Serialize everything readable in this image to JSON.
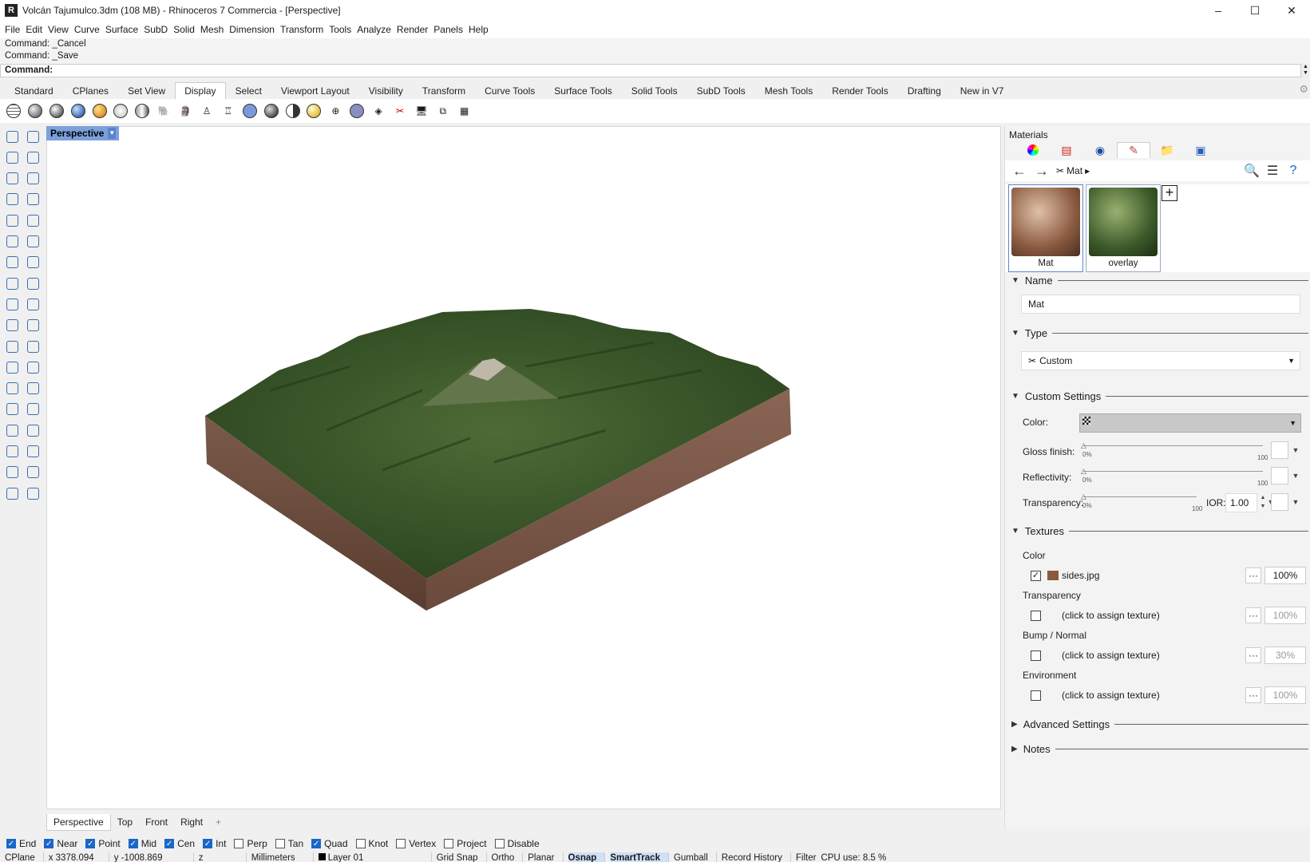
{
  "window": {
    "title": "Volcán Tajumulco.3dm (108 MB) - Rhinoceros 7 Commercia - [Perspective]",
    "minimize": "–",
    "maximize": "☐",
    "close": "✕"
  },
  "menubar": [
    "File",
    "Edit",
    "View",
    "Curve",
    "Surface",
    "SubD",
    "Solid",
    "Mesh",
    "Dimension",
    "Transform",
    "Tools",
    "Analyze",
    "Render",
    "Panels",
    "Help"
  ],
  "command": {
    "history": [
      "Command: _Cancel",
      "Command: _Save"
    ],
    "prompt": "Command:"
  },
  "toolbar_tabs": [
    "Standard",
    "CPlanes",
    "Set View",
    "Display",
    "Select",
    "Viewport Layout",
    "Visibility",
    "Transform",
    "Curve Tools",
    "Surface Tools",
    "Solid Tools",
    "SubD Tools",
    "Mesh Tools",
    "Render Tools",
    "Drafting",
    "New in V7"
  ],
  "active_toolbar_tab": "Display",
  "viewport": {
    "label": "Perspective",
    "tabs": [
      "Perspective",
      "Top",
      "Front",
      "Right"
    ],
    "add_tab": "+"
  },
  "osnaps": [
    {
      "label": "End",
      "checked": true
    },
    {
      "label": "Near",
      "checked": true
    },
    {
      "label": "Point",
      "checked": true
    },
    {
      "label": "Mid",
      "checked": true
    },
    {
      "label": "Cen",
      "checked": true
    },
    {
      "label": "Int",
      "checked": true
    },
    {
      "label": "Perp",
      "checked": false
    },
    {
      "label": "Tan",
      "checked": false
    },
    {
      "label": "Quad",
      "checked": true
    },
    {
      "label": "Knot",
      "checked": false
    },
    {
      "label": "Vertex",
      "checked": false
    },
    {
      "label": "Project",
      "checked": false
    },
    {
      "label": "Disable",
      "checked": false
    }
  ],
  "statusbar": {
    "cplane": "CPlane",
    "x": "x 3378.094",
    "y": "y -1008.869",
    "z": "z",
    "units": "Millimeters",
    "layer": "Layer 01",
    "toggles": [
      "Grid Snap",
      "Ortho",
      "Planar",
      "Osnap",
      "SmartTrack",
      "Gumball",
      "Record History",
      "Filter"
    ],
    "cpu": "CPU use: 8.5 %"
  },
  "materials_panel": {
    "title": "Materials",
    "breadcrumb": "Mat",
    "materials": [
      {
        "name": "Mat"
      },
      {
        "name": "overlay"
      }
    ],
    "sections": {
      "name": "Name",
      "type": "Type",
      "custom": "Custom Settings",
      "textures": "Textures",
      "advanced": "Advanced Settings",
      "notes": "Notes"
    },
    "name_value": "Mat",
    "type_value": "Custom",
    "color_label": "Color:",
    "gloss_label": "Gloss finish:",
    "reflectivity_label": "Reflectivity:",
    "transparency_label": "Transparency:",
    "slider_min": "0%",
    "slider_max": "100",
    "ior_label": "IOR:",
    "ior_value": "1.00",
    "textures": [
      {
        "label": "Color",
        "file": "sides.jpg",
        "checked": true,
        "amount": "100%"
      },
      {
        "label": "Transparency",
        "file": "(click to assign texture)",
        "checked": false,
        "amount": "100%"
      },
      {
        "label": "Bump / Normal",
        "file": "(click to assign texture)",
        "checked": false,
        "amount": "30%"
      },
      {
        "label": "Environment",
        "file": "(click to assign texture)",
        "checked": false,
        "amount": "100%"
      }
    ],
    "dots": "···"
  },
  "colors": {
    "viewport_label": "#7ca0dc",
    "check_on": "#1b66c9",
    "terrain_green": "#3c5a2a",
    "terrain_side": "#6b4a3a"
  }
}
